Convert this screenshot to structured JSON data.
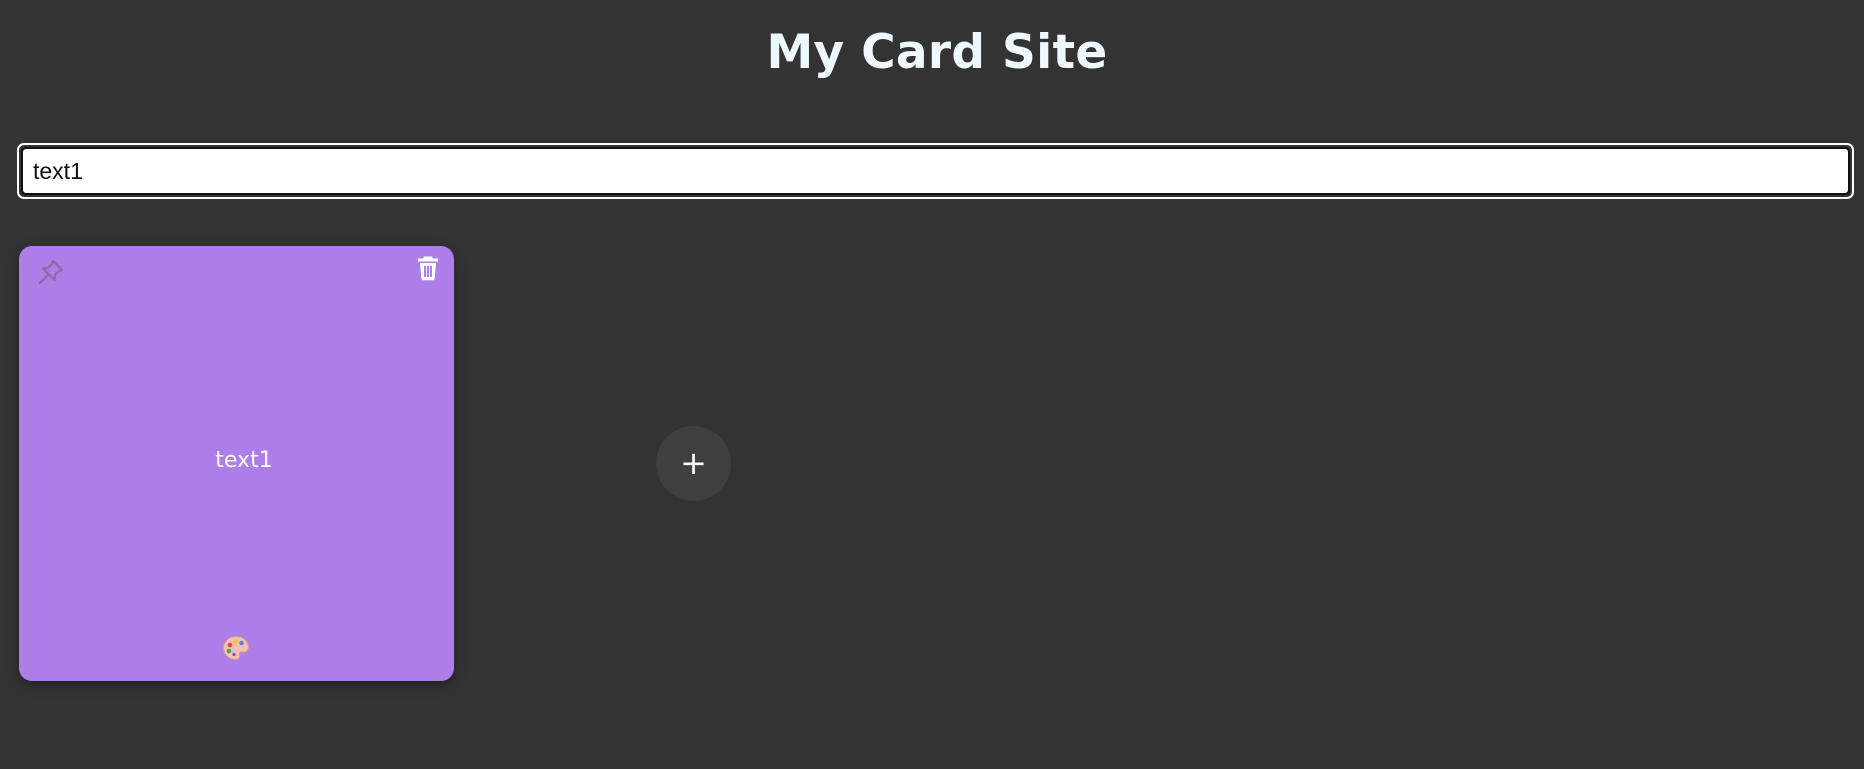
{
  "header": {
    "title": "My Card Site"
  },
  "search": {
    "value": "text1"
  },
  "cards": [
    {
      "text": "text1",
      "color": "#ae7ee8",
      "pin_icon": "pin-icon",
      "delete_icon": "trash-icon",
      "color_picker_icon": "palette-icon"
    }
  ],
  "add_button": {
    "label": "+"
  },
  "colors": {
    "background": "#333333",
    "title": "#eef8ff",
    "add_button_bg": "#3f3f3f"
  }
}
